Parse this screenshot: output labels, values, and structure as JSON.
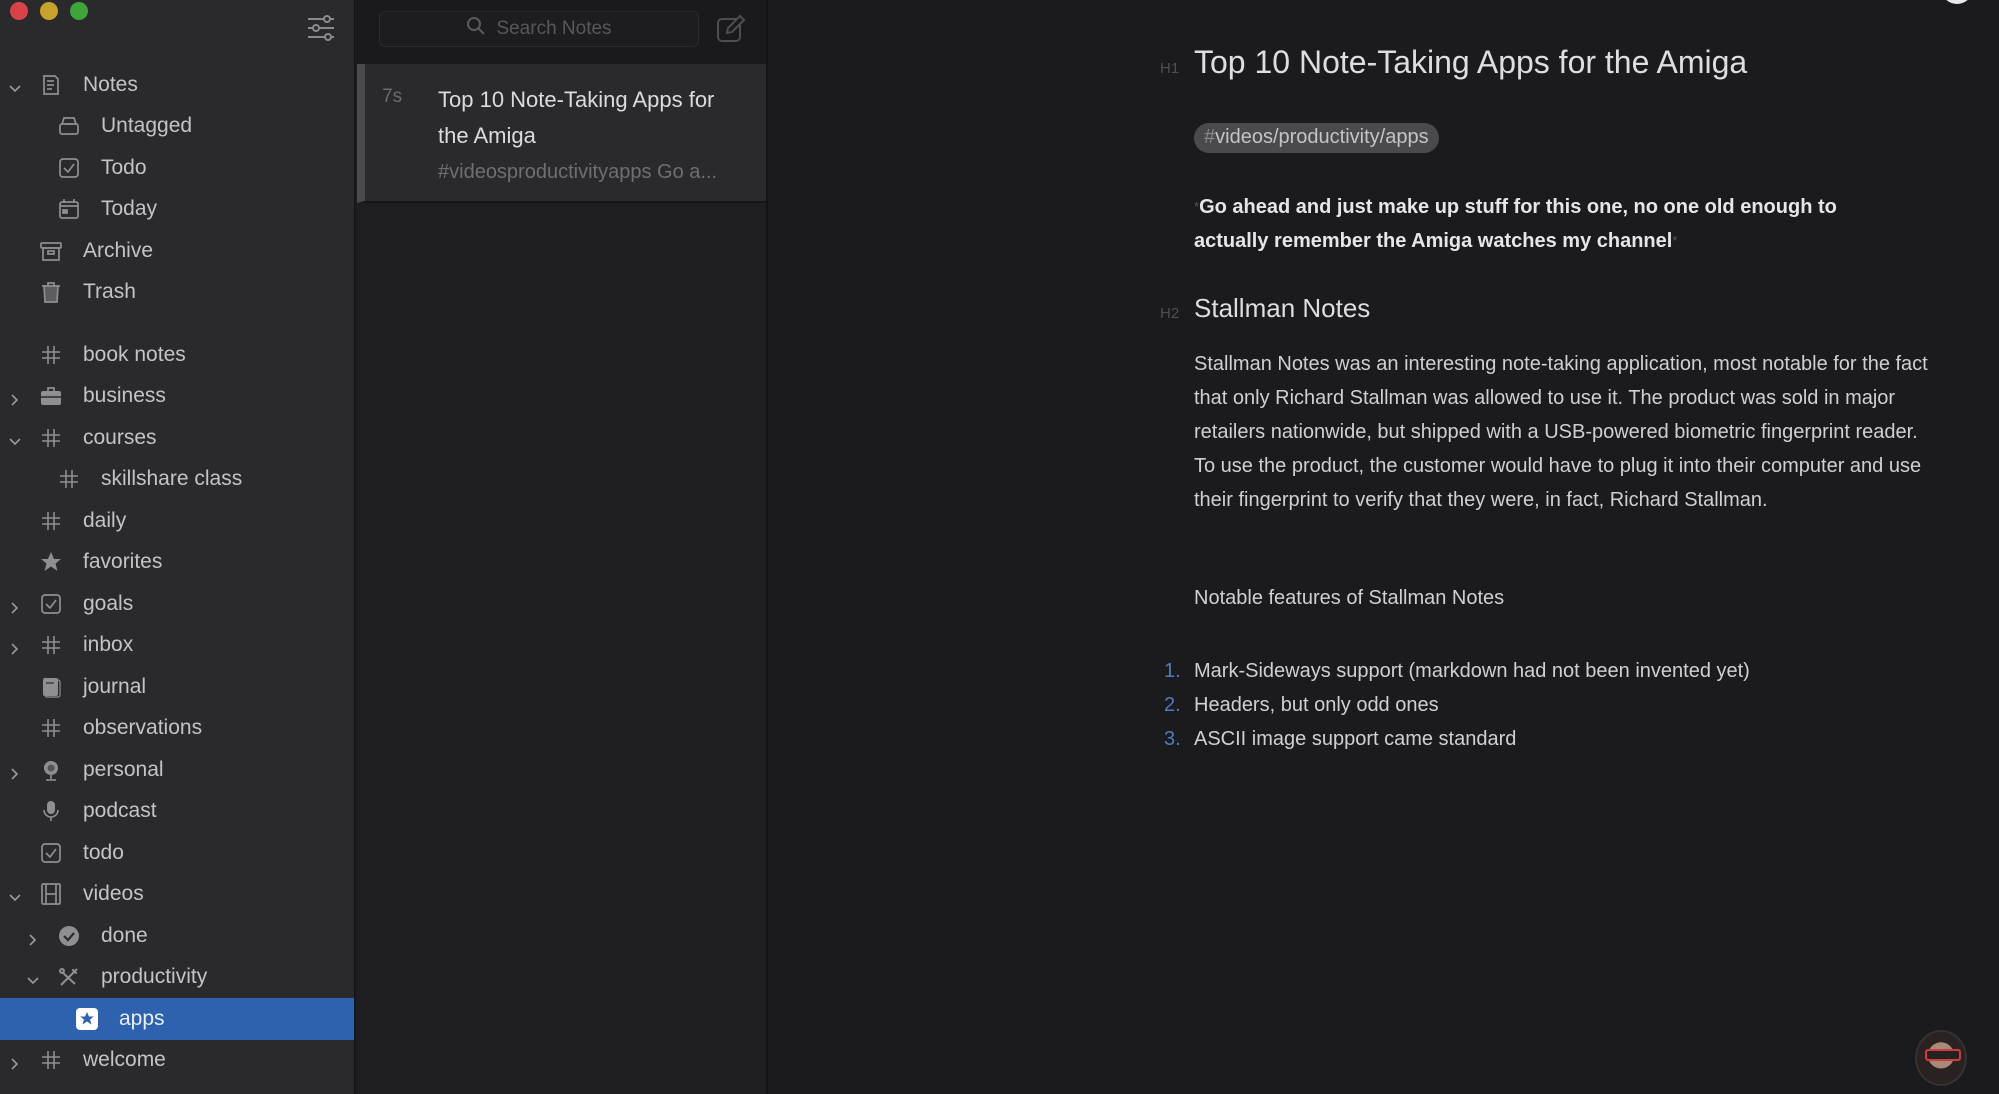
{
  "window": {
    "controls": [
      "close",
      "minimize",
      "maximize"
    ]
  },
  "sidebar": {
    "filter_icon": "sliders-icon",
    "items": [
      {
        "label": "Notes",
        "icon": "note-icon",
        "chevron": "down",
        "level": 0
      },
      {
        "label": "Untagged",
        "icon": "tray-icon",
        "chevron": "none",
        "level": 1
      },
      {
        "label": "Todo",
        "icon": "checkbox-icon",
        "chevron": "none",
        "level": 1
      },
      {
        "label": "Today",
        "icon": "calendar-icon",
        "chevron": "none",
        "level": 1
      },
      {
        "label": "Archive",
        "icon": "archive-box-icon",
        "chevron": "none",
        "level": 0
      },
      {
        "label": "Trash",
        "icon": "trash-icon",
        "chevron": "none",
        "level": 0
      },
      {
        "label": "book notes",
        "icon": "hashtag-icon",
        "chevron": "none",
        "level": 0,
        "gap": true
      },
      {
        "label": "business",
        "icon": "briefcase-icon",
        "chevron": "right",
        "level": 0
      },
      {
        "label": "courses",
        "icon": "hashtag-icon",
        "chevron": "down",
        "level": 0
      },
      {
        "label": "skillshare class",
        "icon": "hashtag-icon",
        "chevron": "none",
        "level": 1
      },
      {
        "label": "daily",
        "icon": "hashtag-icon",
        "chevron": "none",
        "level": 0
      },
      {
        "label": "favorites",
        "icon": "star-icon",
        "chevron": "none",
        "level": 0
      },
      {
        "label": "goals",
        "icon": "checkbox-icon",
        "chevron": "right",
        "level": 0
      },
      {
        "label": "inbox",
        "icon": "hashtag-icon",
        "chevron": "right",
        "level": 0
      },
      {
        "label": "journal",
        "icon": "book-icon",
        "chevron": "none",
        "level": 0
      },
      {
        "label": "observations",
        "icon": "hashtag-icon",
        "chevron": "none",
        "level": 0
      },
      {
        "label": "personal",
        "icon": "webcam-icon",
        "chevron": "right",
        "level": 0
      },
      {
        "label": "podcast",
        "icon": "microphone-icon",
        "chevron": "none",
        "level": 0
      },
      {
        "label": "todo",
        "icon": "checkbox-icon",
        "chevron": "none",
        "level": 0
      },
      {
        "label": "videos",
        "icon": "film-icon",
        "chevron": "down",
        "level": 0
      },
      {
        "label": "done",
        "icon": "check-circle-icon",
        "chevron": "right",
        "level": 1
      },
      {
        "label": "productivity",
        "icon": "tools-icon",
        "chevron": "down",
        "level": 1
      },
      {
        "label": "apps",
        "icon": "star-badge-icon",
        "chevron": "none",
        "level": 2,
        "selected": true
      },
      {
        "label": "welcome",
        "icon": "hashtag-icon",
        "chevron": "right",
        "level": 0
      }
    ]
  },
  "notelist": {
    "search_placeholder": "Search Notes",
    "notes": [
      {
        "age": "7s",
        "title": "Top 10 Note-Taking Apps for the Amiga",
        "snippet": "#videosproductivityapps Go a..."
      }
    ]
  },
  "editor": {
    "h1_marker": "H1",
    "title": "Top 10 Note-Taking Apps for the Amiga",
    "tag_hash": "#",
    "tag": "videos/productivity/apps",
    "emphasis_marker": "*",
    "quote": "Go ahead and just make up stuff for this one, no one old enough to actually remember the Amiga watches my channel",
    "h2_marker": "H2",
    "h2": "Stallman Notes",
    "paragraph": "Stallman Notes was an interesting note-taking application, most notable for the fact that only Richard Stallman was allowed to use it. The product was sold in major retailers nationwide, but shipped with a USB-powered biometric fingerprint reader. To use the product, the customer would have to plug it into their computer and use their fingerprint to verify that they were, in fact, Richard Stallman.",
    "paragraph2": "Notable features of Stallman Notes",
    "list": [
      {
        "num": "1.",
        "text": "Mark-Sideways support (markdown had not been invented yet)"
      },
      {
        "num": "2.",
        "text": "Headers, but only odd ones"
      },
      {
        "num": "3.",
        "text": "ASCII image support came standard"
      }
    ]
  },
  "colors": {
    "selection": "#2f62ae",
    "list_number": "#4f7bbf",
    "background": "#1b1b1d",
    "sidebar": "#2a2a2c"
  }
}
